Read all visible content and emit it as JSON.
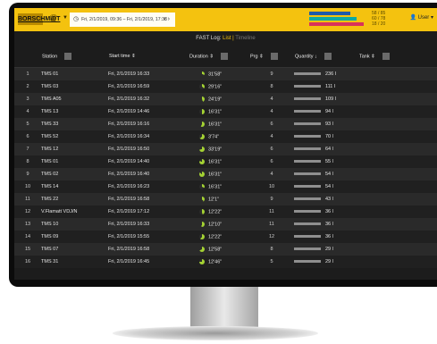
{
  "header": {
    "logo_text": "BORSCHMIDT",
    "date_range": "Fri, 2/1/2019, 09:36 – Fri, 2/1/2019, 17:38",
    "user_label": "User",
    "stats": [
      {
        "label": "58 / 85",
        "fraction": 0.68,
        "color": "#1e5aa8"
      },
      {
        "label": "60 / 78",
        "fraction": 0.77,
        "color": "#0fa9a0"
      },
      {
        "label": "18 / 20",
        "fraction": 0.9,
        "color": "#d9315a"
      }
    ]
  },
  "subheader": {
    "title": "FAST Log:",
    "active_tab": "List",
    "separator": "|",
    "inactive_tab": "Timeline"
  },
  "table": {
    "columns": {
      "station": "Station",
      "start": "Start time",
      "duration": "Duration",
      "prg": "Prg",
      "quantity": "Quantity",
      "tank": "Tank"
    },
    "rows": [
      {
        "n": "1",
        "station": "TMS 01",
        "start": "Fri, 2/1/2019 16:33",
        "duration": "31'58\"",
        "prg": "9",
        "qty": "236 l"
      },
      {
        "n": "2",
        "station": "TMS 03",
        "start": "Fri, 2/1/2019 16:59",
        "duration": "29'16\"",
        "prg": "8",
        "qty": "111 l"
      },
      {
        "n": "3",
        "station": "TMS A05",
        "start": "Fri, 2/1/2019 16:32",
        "duration": "24'19\"",
        "prg": "4",
        "qty": "109 l"
      },
      {
        "n": "4",
        "station": "TMS 13",
        "start": "Fri, 2/1/2019 14:46",
        "duration": "16'31\"",
        "prg": "4",
        "qty": "94 l"
      },
      {
        "n": "5",
        "station": "TMS 33",
        "start": "Fri, 2/1/2019 16:16",
        "duration": "16'31\"",
        "prg": "6",
        "qty": "93 l"
      },
      {
        "n": "6",
        "station": "TMS 52",
        "start": "Fri, 2/1/2019 16:34",
        "duration": "3'74\"",
        "prg": "4",
        "qty": "70 l"
      },
      {
        "n": "7",
        "station": "TMS 12",
        "start": "Fri, 2/1/2019 16:50",
        "duration": "33'19\"",
        "prg": "6",
        "qty": "64 l"
      },
      {
        "n": "8",
        "station": "TMS 01",
        "start": "Fri, 2/1/2019 14:40",
        "duration": "16'31\"",
        "prg": "6",
        "qty": "55 l"
      },
      {
        "n": "9",
        "station": "TMS 02",
        "start": "Fri, 2/1/2019 16:40",
        "duration": "16'31\"",
        "prg": "4",
        "qty": "54 l"
      },
      {
        "n": "10",
        "station": "TMS 14",
        "start": "Fri, 2/1/2019 16:23",
        "duration": "16'31\"",
        "prg": "10",
        "qty": "54 l"
      },
      {
        "n": "11",
        "station": "TMS 22",
        "start": "Fri, 2/1/2019 16:58",
        "duration": "12'1\"",
        "prg": "9",
        "qty": "43 l"
      },
      {
        "n": "12",
        "station": "V.Flamatt VDJ/N",
        "start": "Fri, 2/1/2019 17:12",
        "duration": "12'22\"",
        "prg": "11",
        "qty": "36 l"
      },
      {
        "n": "13",
        "station": "TMS 10",
        "start": "Fri, 2/1/2019 16:33",
        "duration": "12'10\"",
        "prg": "11",
        "qty": "36 l"
      },
      {
        "n": "14",
        "station": "TMS 09",
        "start": "Fri, 2/1/2019 15:55",
        "duration": "12'22\"",
        "prg": "12",
        "qty": "36 l"
      },
      {
        "n": "15",
        "station": "TMS 07",
        "start": "Fri, 2/1/2019 16:58",
        "duration": "12'58\"",
        "prg": "8",
        "qty": "29 l"
      },
      {
        "n": "16",
        "station": "TMS 31",
        "start": "Fri, 2/1/2019 16:45",
        "duration": "12'46\"",
        "prg": "5",
        "qty": "29 l"
      }
    ]
  }
}
